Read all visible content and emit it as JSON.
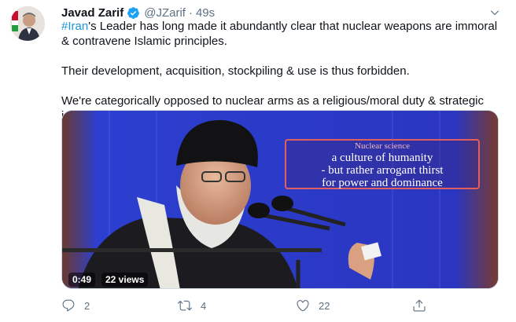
{
  "tweet": {
    "display_name": "Javad Zarif",
    "handle": "@JZarif",
    "separator": "·",
    "time": "49s",
    "text": {
      "p1_hashtag": "#Iran",
      "p1_rest": "'s Leader has long made it abundantly clear that nuclear weapons are immoral & contravene Islamic principles.",
      "p2": "Their development, acquisition, stockpiling & use is thus forbidden.",
      "p3": "We're categorically opposed to nuclear arms as a religious/moral duty & strategic imperative."
    },
    "media": {
      "caption_title": "Nuclear science",
      "caption_line1": "a culture of humanity",
      "caption_line2": "- but rather arrogant thirst",
      "caption_line3": "for power and dominance",
      "duration": "0:49",
      "views": "22 views"
    },
    "actions": {
      "reply_count": "2",
      "retweet_count": "4",
      "like_count": "22"
    },
    "colors": {
      "hashtag": "#1b95e0",
      "verified": "#1da1f2",
      "meta_gray": "#5b7083",
      "media_background": "#2a3cc7"
    },
    "icons": [
      "verified-badge-icon",
      "chevron-down-icon",
      "reply-icon",
      "retweet-icon",
      "like-icon",
      "share-icon"
    ]
  }
}
